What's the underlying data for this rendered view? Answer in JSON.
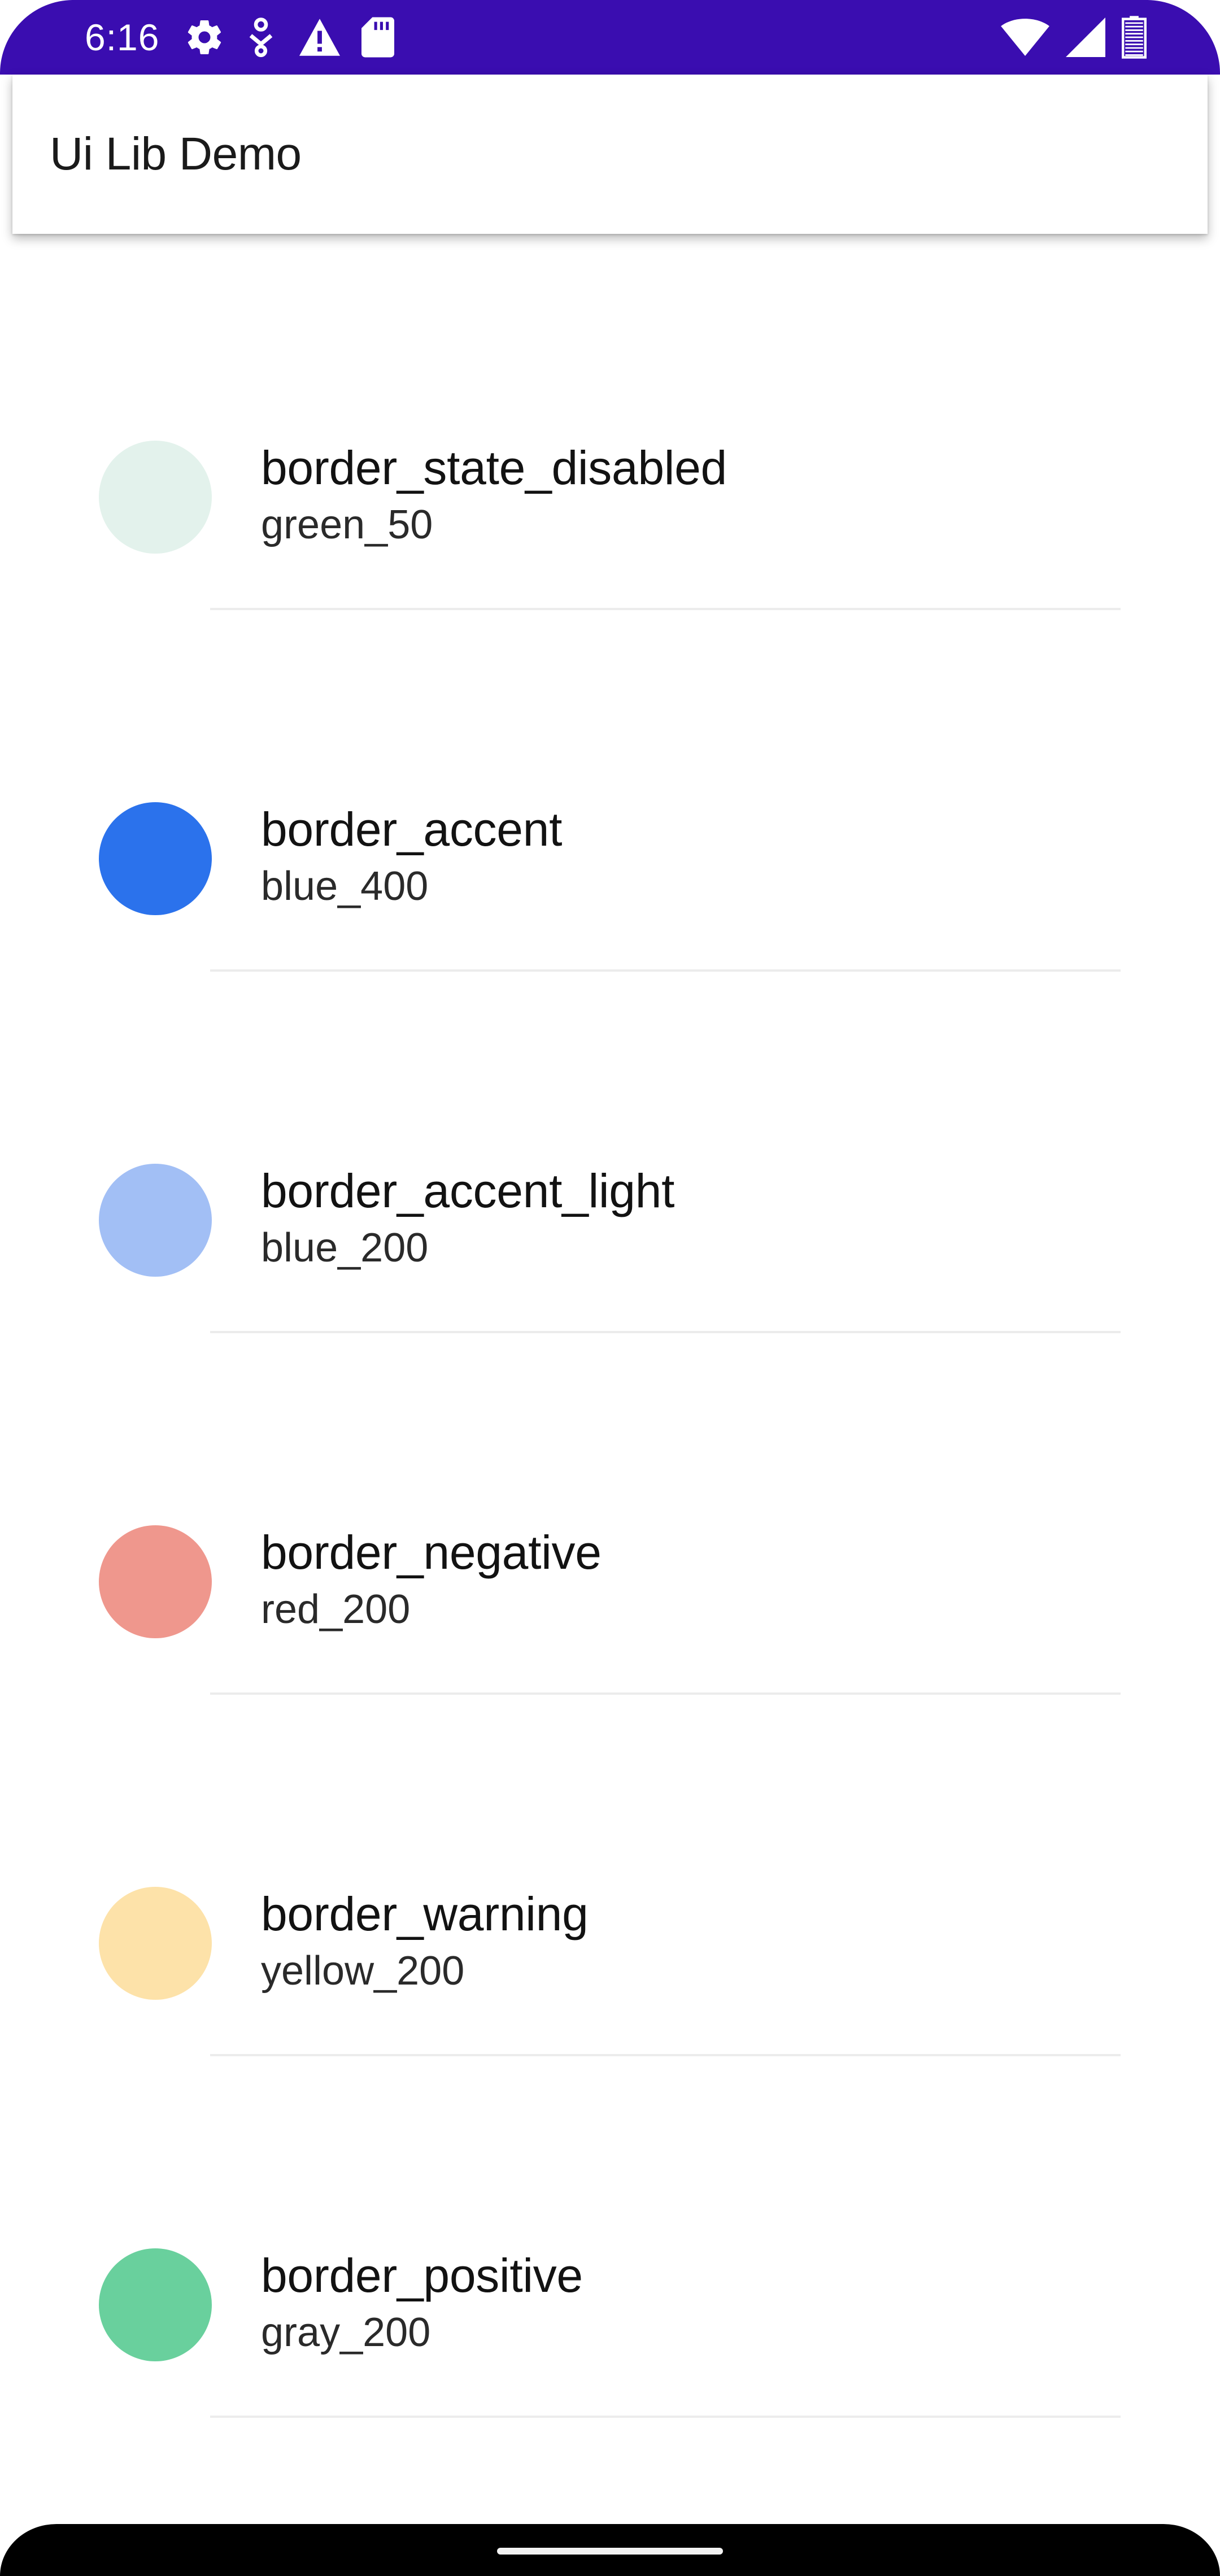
{
  "status_bar": {
    "time": "6:16",
    "background_color": "#3a0db0",
    "left_icons": [
      "settings-gear-icon",
      "download-person-icon",
      "warning-icon",
      "sd-card-icon"
    ],
    "right_icons": [
      "wifi-icon",
      "cell-signal-icon",
      "battery-icon"
    ]
  },
  "app_bar": {
    "title": "Ui Lib Demo"
  },
  "color_list": [
    {
      "name": "border_state_disabled",
      "value": "green_50",
      "swatch_color": "#e3f2ec"
    },
    {
      "name": "border_accent",
      "value": "blue_400",
      "swatch_color": "#2b72ec"
    },
    {
      "name": "border_accent_light",
      "value": "blue_200",
      "swatch_color": "#a2bff5"
    },
    {
      "name": "border_negative",
      "value": "red_200",
      "swatch_color": "#ef978d"
    },
    {
      "name": "border_warning",
      "value": "yellow_200",
      "swatch_color": "#fde2a9"
    },
    {
      "name": "border_positive",
      "value": "gray_200",
      "swatch_color": "#69d09d"
    }
  ]
}
